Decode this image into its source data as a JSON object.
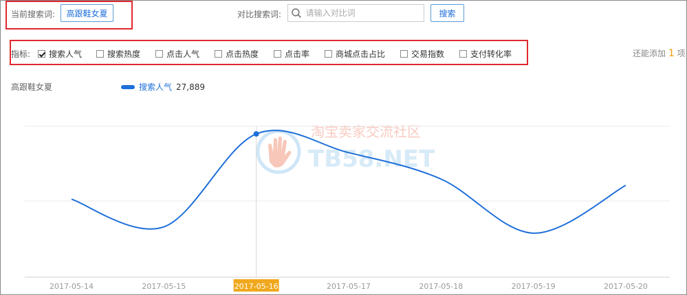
{
  "search": {
    "current_label": "当前搜索词:",
    "current_term": "高跟鞋女夏",
    "compare_label": "对比搜索词:",
    "compare_placeholder": "请输入对比词",
    "search_button": "搜索"
  },
  "metrics": {
    "label": "指标:",
    "items": [
      {
        "label": "搜索人气",
        "checked": true
      },
      {
        "label": "搜索热度",
        "checked": false
      },
      {
        "label": "点击人气",
        "checked": false
      },
      {
        "label": "点击热度",
        "checked": false
      },
      {
        "label": "点击率",
        "checked": false
      },
      {
        "label": "商城点击占比",
        "checked": false
      },
      {
        "label": "交易指数",
        "checked": false
      },
      {
        "label": "支付转化率",
        "checked": false
      }
    ],
    "add_prefix": "还能添加",
    "add_count": "1",
    "add_suffix": "项"
  },
  "legend": {
    "series_label": "高跟鞋女夏",
    "name": "搜索人气",
    "value": "27,889"
  },
  "watermark": {
    "text_cn": "淘宝卖家交流社区",
    "text_en": "TB58.NET"
  },
  "colors": {
    "line": "#1e6fd9",
    "highlight": "#f0a81c",
    "red_box": "#e0282e"
  },
  "chart_data": {
    "type": "line",
    "x": [
      "2017-05-14",
      "2017-05-15",
      "2017-05-16",
      "2017-05-17",
      "2017-05-18",
      "2017-05-19",
      "2017-05-20"
    ],
    "series": [
      {
        "name": "搜索人气",
        "values": [
          22700,
          20500,
          27889,
          26400,
          24300,
          20000,
          23800
        ]
      }
    ],
    "highlight_index": 2,
    "ylim": [
      16500,
      28500
    ],
    "grid": true
  }
}
